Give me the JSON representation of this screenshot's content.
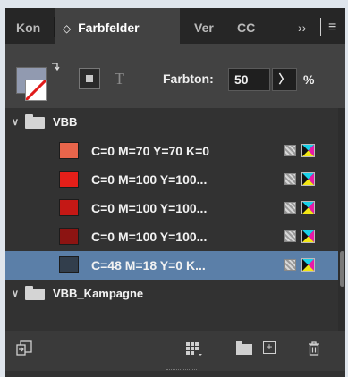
{
  "tabs": {
    "items": [
      {
        "label": "Kon"
      },
      {
        "label": "Farbfelder",
        "glyph": "◇"
      },
      {
        "label": "Ver"
      },
      {
        "label": "CC"
      }
    ],
    "overflow": "››",
    "menu": "≡"
  },
  "toolbar": {
    "fill_color": "#919ab0",
    "tint_label": "Farbton:",
    "tint_value": "50",
    "tint_arrow": "〉",
    "tint_unit": "%",
    "text_toggle": "T"
  },
  "swatches": {
    "groups": [
      {
        "name": "VBB"
      },
      {
        "name": "VBB_Kampagne"
      }
    ],
    "rows": [
      {
        "label": "C=0 M=70 Y=70 K=0",
        "color": "#e8654b"
      },
      {
        "label": "C=0 M=100 Y=100...",
        "color": "#e41f19"
      },
      {
        "label": "C=0 M=100 Y=100...",
        "color": "#c41815"
      },
      {
        "label": "C=0 M=100 Y=100...",
        "color": "#8c1412"
      },
      {
        "label": "C=48 M=18 Y=0 K...",
        "color": "#323e4c"
      }
    ],
    "selected_index": 4
  },
  "colors": {
    "panel_bg": "#323232",
    "selection": "#5b7fa8"
  }
}
